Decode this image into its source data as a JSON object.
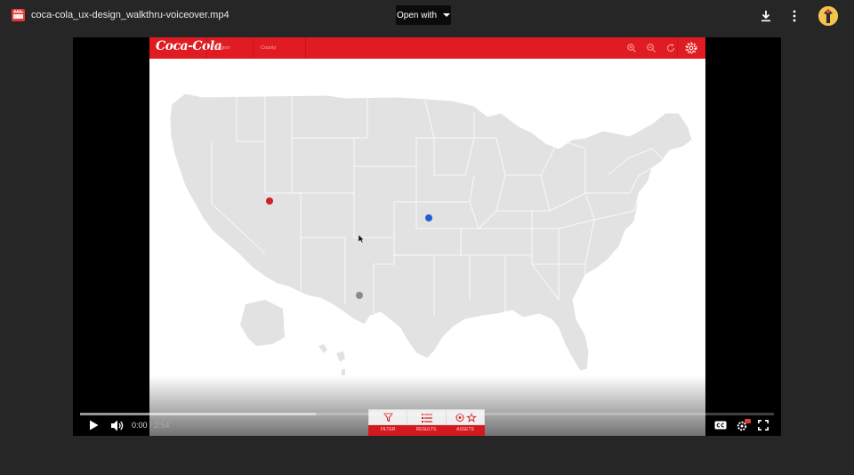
{
  "topbar": {
    "file_icon": "video-file-icon",
    "file_name": "coca-cola_ux-design_walkthru-voiceover.mp4",
    "open_with_label": "Open with",
    "download_icon": "download-icon",
    "more_icon": "more-vert-icon",
    "avatar_icon": "user-avatar"
  },
  "app": {
    "logo_text": "Coca-Cola",
    "tabs": [
      "Region",
      "County"
    ],
    "header_icons": [
      "zoom-in-icon",
      "zoom-out-icon",
      "refresh-icon",
      "settings-gear-icon"
    ],
    "brand_color": "#e11b22",
    "map": {
      "title": "",
      "pins": [
        {
          "color": "#d0202a",
          "label": ""
        },
        {
          "color": "#1f5fd6",
          "label": ""
        },
        {
          "color": "#8a8a8a",
          "label": ""
        }
      ]
    },
    "bottom_panel": {
      "items": [
        {
          "label": "FILTER",
          "icon": "filter-icon"
        },
        {
          "label": "RESULTS",
          "icon": "list-icon"
        },
        {
          "label": "ASSETS",
          "icon": "target-star-icon"
        }
      ]
    }
  },
  "player": {
    "current_time": "0:00",
    "duration": "2:54",
    "time_separator": " / ",
    "progress_fraction": 0.0,
    "buffered_fraction": 0.34,
    "controls": [
      "play-icon",
      "volume-icon",
      "captions-icon",
      "settings-hd-icon",
      "fullscreen-icon"
    ]
  }
}
